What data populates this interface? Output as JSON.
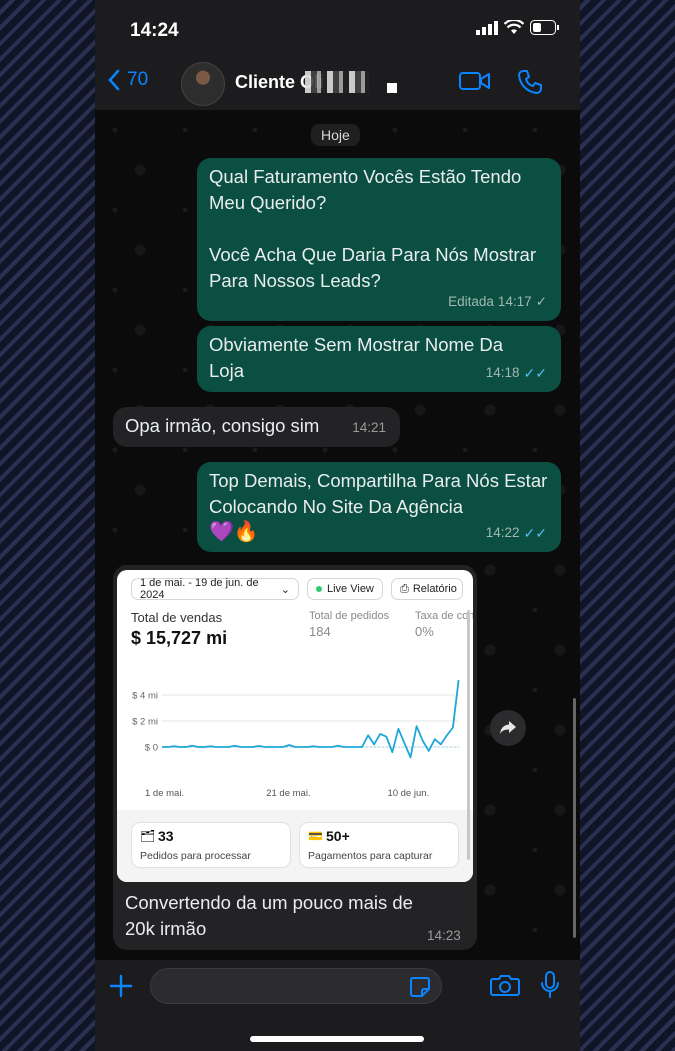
{
  "status": {
    "time": "14:24"
  },
  "header": {
    "back_count": "70",
    "contact_name": "Cliente Oli"
  },
  "chat": {
    "day_label": "Hoje",
    "messages": [
      {
        "text": "Qual Faturamento Vocês Estão Tendo Meu Querido?\n\nVocê Acha Que Daria Para Nós Mostrar Para Nossos Leads?",
        "edited": "Editada",
        "time": "14:17"
      },
      {
        "text": "Obviamente Sem Mostrar Nome Da Loja",
        "time": "14:18"
      },
      {
        "text": "Opa irmão, consigo sim",
        "time": "14:21"
      },
      {
        "text": "Top Demais, Compartilha Para Nós Estar Colocando No Site Da Agência",
        "emoji": "💜🔥",
        "time": "14:22"
      },
      {
        "caption": "Convertendo da um pouco mais de 20k irmão",
        "time": "14:23"
      }
    ]
  },
  "screenshot_card": {
    "date_range": "1 de mai. - 19 de jun. de 2024",
    "live_view": "Live View",
    "report": "Relatório",
    "total_sales_label": "Total de vendas",
    "total_sales_value": "$ 15,727 mi",
    "total_orders_label": "Total de pedidos",
    "total_orders_value": "184",
    "conversion_label": "Taxa de con",
    "conversion_value": "0%",
    "stat1_value": "33",
    "stat1_label": "Pedidos para processar",
    "stat2_value": "50+",
    "stat2_label": "Pagamentos para capturar"
  },
  "chart_data": {
    "type": "line",
    "x": [
      0,
      1,
      2,
      3,
      4,
      5,
      6,
      7,
      8,
      9,
      10,
      11,
      12,
      13,
      14,
      15,
      16,
      17,
      18,
      19,
      20,
      21,
      22,
      23,
      24,
      25,
      26,
      27,
      28,
      29,
      30,
      31,
      32,
      33,
      34,
      35,
      36,
      37,
      38,
      39,
      40,
      41,
      42,
      43,
      44,
      45,
      46,
      47,
      48,
      49
    ],
    "xticks": [
      "1 de mai.",
      "21 de mai.",
      "10 de jun."
    ],
    "yticks": [
      "$ 4 mi",
      "$ 2 mi",
      "$ 0"
    ],
    "ylim": [
      -1,
      5
    ],
    "series": [
      {
        "values": [
          0,
          0,
          0.05,
          0,
          0,
          0.1,
          0,
          0,
          0.05,
          0,
          0,
          0,
          0.1,
          0,
          0,
          0,
          0.08,
          0,
          0,
          0,
          0,
          0.15,
          0,
          0,
          0,
          0.05,
          0,
          0,
          0,
          0.1,
          0,
          0,
          0,
          0,
          0.9,
          0.2,
          1,
          0.8,
          -0.4,
          1.4,
          0.3,
          -0.8,
          1.6,
          0.5,
          -0.3,
          0.6,
          0.2,
          0.9,
          1.5,
          5.4
        ]
      }
    ]
  },
  "colors": {
    "out_bubble": "#0b4f42",
    "in_bubble": "#232325",
    "accent": "#0a84ff",
    "line": "#1ea7d8"
  }
}
